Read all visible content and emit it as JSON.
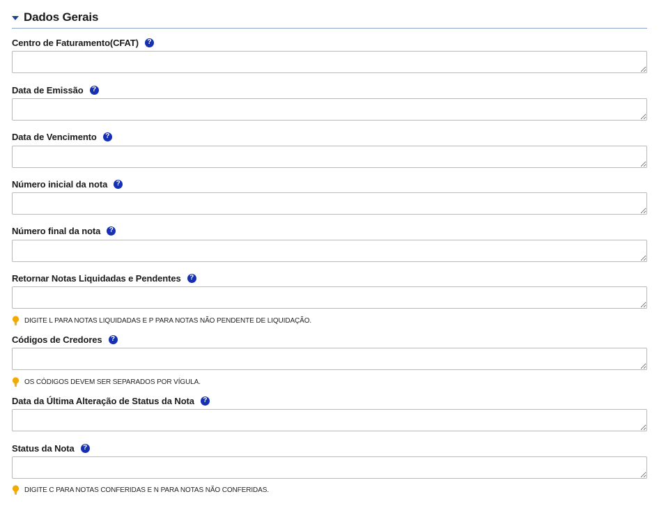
{
  "section": {
    "title": "Dados Gerais"
  },
  "help_symbol": "?",
  "fields": [
    {
      "label": "Centro de Faturamento(CFAT)",
      "value": ""
    },
    {
      "label": "Data de Emissão",
      "value": ""
    },
    {
      "label": "Data de Vencimento",
      "value": ""
    },
    {
      "label": "Número inicial da nota",
      "value": ""
    },
    {
      "label": "Número final da nota",
      "value": ""
    },
    {
      "label": "Retornar Notas Liquidadas e Pendentes",
      "value": "",
      "hint": "DIGITE L PARA NOTAS LIQUIDADAS E P PARA NOTAS NÃO PENDENTE DE LIQUIDAÇÃO."
    },
    {
      "label": "Códigos de Credores",
      "value": "",
      "hint": "OS CÓDIGOS DEVEM SER SEPARADOS POR VÍGULA."
    },
    {
      "label": "Data da Última Alteração de Status da Nota",
      "value": ""
    },
    {
      "label": "Status da Nota",
      "value": "",
      "hint": "DIGITE C PARA NOTAS CONFERIDAS E N PARA NOTAS NÃO CONFERIDAS."
    }
  ],
  "colors": {
    "help_icon": "#1530b5",
    "hint_bulb": "#f2a900",
    "section_rule": "#8aa7c9",
    "input_border": "#b9b9b9"
  },
  "icons": {
    "section_toggle": "caret-down-icon",
    "help": "help-icon",
    "hint": "lightbulb-icon"
  }
}
